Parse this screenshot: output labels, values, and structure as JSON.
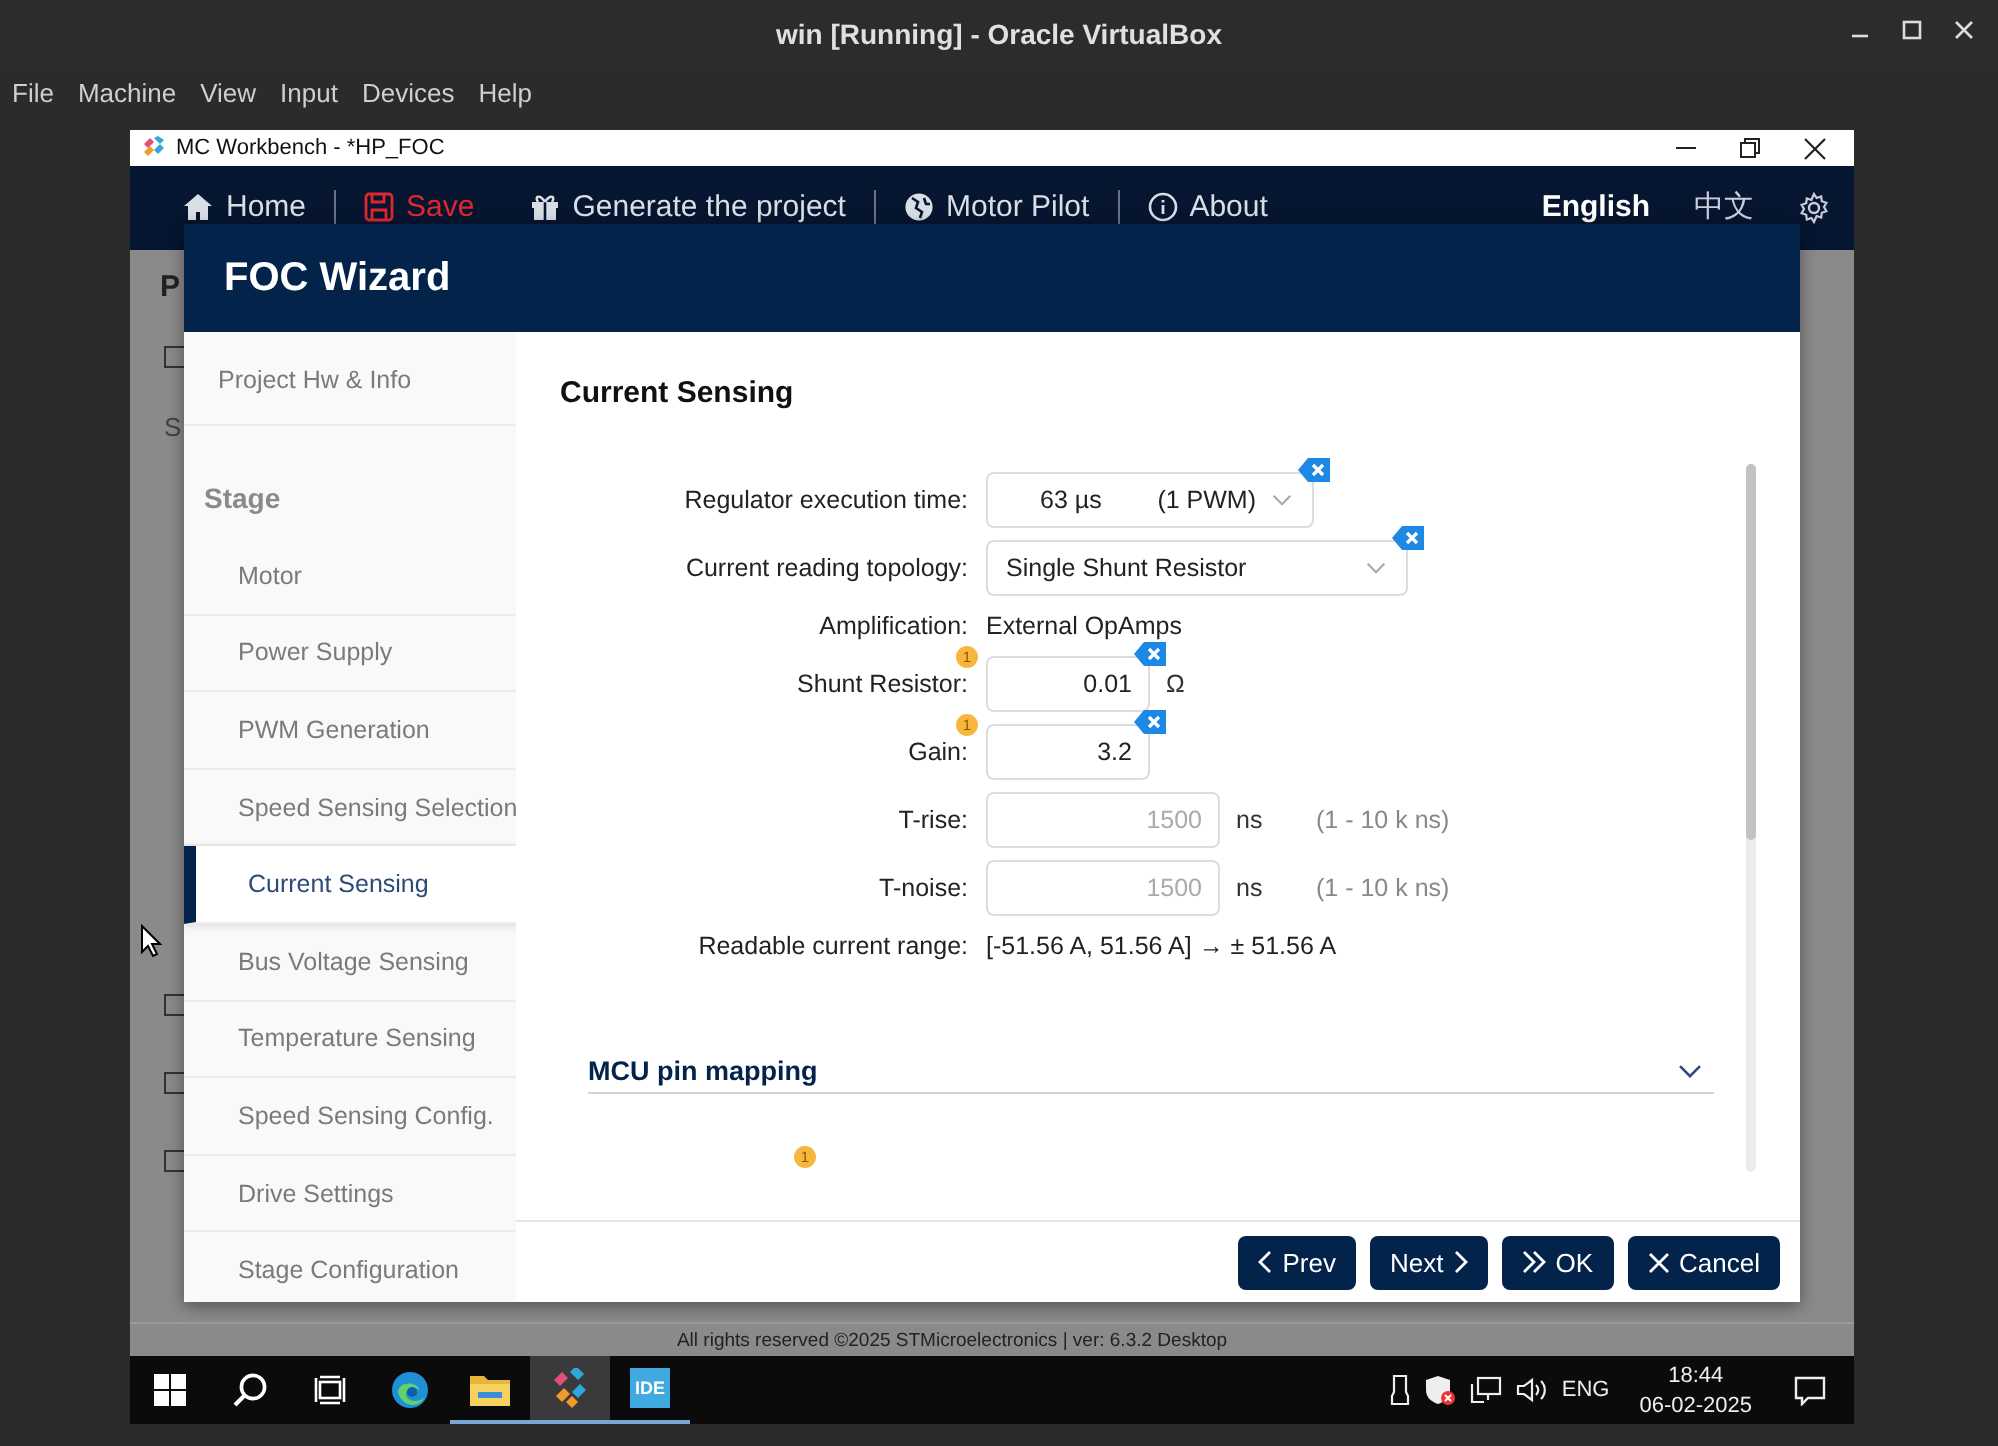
{
  "vbox": {
    "title": "win [Running] - Oracle VirtualBox",
    "menu": [
      "File",
      "Machine",
      "View",
      "Input",
      "Devices",
      "Help"
    ]
  },
  "app": {
    "title": "MC Workbench - *HP_FOC",
    "nav": [
      {
        "kind": "home",
        "label": "Home",
        "separator": true
      },
      {
        "kind": "save",
        "label": "Save",
        "separator": false
      },
      {
        "kind": "generate",
        "label": "Generate the project",
        "separator": true
      },
      {
        "kind": "pilot",
        "label": "Motor Pilot",
        "separator": true
      },
      {
        "kind": "about",
        "label": "About",
        "separator": false
      }
    ],
    "languages": [
      {
        "label": "English",
        "selected": true
      },
      {
        "label": "中文",
        "selected": false
      }
    ],
    "background_page": {
      "heading": "P",
      "label": "S",
      "checkboxes": [
        {
          "checked": false
        },
        {
          "checked": false
        },
        {
          "checked": false
        },
        {
          "checked": false
        }
      ]
    },
    "footer": "All rights reserved ©2025 STMicroelectronics | ver: 6.3.2 Desktop"
  },
  "wizard": {
    "title": "FOC Wizard",
    "steps": [
      {
        "kind": "item",
        "label": "Project Hw & Info",
        "selected": false
      },
      {
        "kind": "section",
        "label": "Stage"
      },
      {
        "kind": "subitem",
        "label": "Motor",
        "selected": false
      },
      {
        "kind": "subitem",
        "label": "Power Supply",
        "selected": false
      },
      {
        "kind": "subitem",
        "label": "PWM Generation",
        "selected": false
      },
      {
        "kind": "subitem",
        "label": "Speed Sensing Selection",
        "selected": false
      },
      {
        "kind": "subitem",
        "label": "Current Sensing",
        "selected": true
      },
      {
        "kind": "subitem",
        "label": "Bus Voltage Sensing",
        "selected": false
      },
      {
        "kind": "subitem",
        "label": "Temperature Sensing",
        "selected": false
      },
      {
        "kind": "subitem",
        "label": "Speed Sensing Config.",
        "selected": false
      },
      {
        "kind": "subitem",
        "label": "Drive Settings",
        "selected": false
      },
      {
        "kind": "subitem",
        "label": "Stage Configuration",
        "selected": false
      }
    ],
    "page_title": "Current Sensing",
    "fields": [
      {
        "kind": "select",
        "label": "Regulator execution time:",
        "value": "63 µs",
        "extra": "(1 PWM)",
        "clearable": true
      },
      {
        "kind": "select",
        "label": "Current reading topology:",
        "value": "Single Shunt Resistor",
        "clearable": true
      },
      {
        "kind": "text",
        "label": "Amplification:",
        "value": "External OpAmps"
      },
      {
        "kind": "input",
        "label": "Shunt Resistor:",
        "value": "0.01",
        "unit": "Ω",
        "badge": "1",
        "clearable": true,
        "disabled": false
      },
      {
        "kind": "input",
        "label": "Gain:",
        "value": "3.2",
        "badge": "1",
        "clearable": true,
        "disabled": false
      },
      {
        "kind": "input",
        "label": "T-rise:",
        "value": "1500",
        "unit": "ns",
        "range": "(1 - 10 k ns)",
        "clearable": false,
        "disabled": true
      },
      {
        "kind": "input",
        "label": "T-noise:",
        "value": "1500",
        "unit": "ns",
        "range": "(1 - 10 k ns)",
        "clearable": false,
        "disabled": true
      },
      {
        "kind": "text",
        "label": "Readable current range:",
        "value": "[-51.56 A, 51.56 A] → ± 51.56 A"
      }
    ],
    "sections": [
      {
        "title": "MCU pin mapping",
        "badge": "1"
      }
    ],
    "buttons": [
      {
        "kind": "prev",
        "label": "Prev"
      },
      {
        "kind": "next",
        "label": "Next"
      },
      {
        "kind": "ok",
        "label": "OK"
      },
      {
        "kind": "cancel",
        "label": "Cancel"
      }
    ]
  },
  "taskbar": {
    "apps": [
      {
        "kind": "start",
        "open": false,
        "selected": false
      },
      {
        "kind": "search",
        "open": false,
        "selected": false
      },
      {
        "kind": "taskview",
        "open": false,
        "selected": false
      },
      {
        "kind": "browser",
        "open": false,
        "selected": false
      },
      {
        "kind": "folder",
        "open": true,
        "selected": false
      },
      {
        "kind": "workbench",
        "open": true,
        "selected": true
      },
      {
        "kind": "ide",
        "label": "IDE",
        "open": true,
        "selected": false
      }
    ],
    "tray": {
      "language": "ENG",
      "time": "18:44",
      "date": "06-02-2025"
    }
  }
}
